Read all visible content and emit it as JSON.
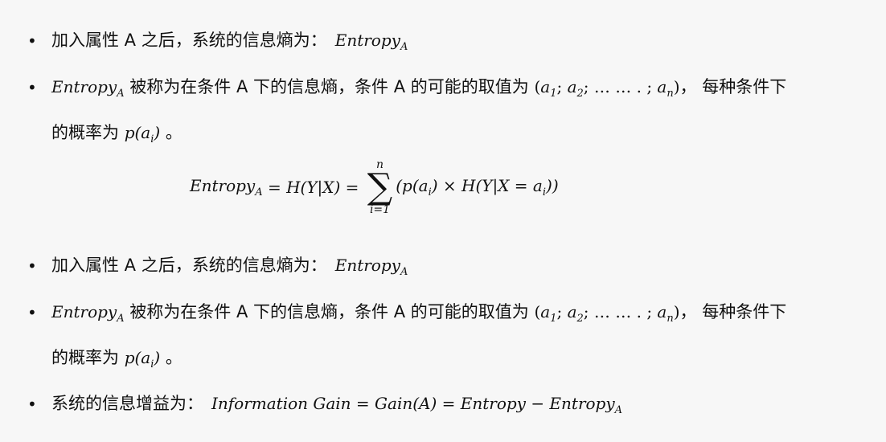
{
  "doc": {
    "bullet_symbol": "•",
    "item1": {
      "text": "加入属性 A 之后，系统的信息熵为：",
      "math_main": "Entropy",
      "math_sub": "A"
    },
    "item2": {
      "math_main": "Entropy",
      "math_sub": "A",
      "text_a": "被称为在条件 A 下的信息熵，条件 A 的可能的取值为",
      "open_paren": "(",
      "a1": "a",
      "a1_sub": "1",
      "sep1": "; ",
      "a2": "a",
      "a2_sub": "2",
      "sep2": "; … … . ; ",
      "an": "a",
      "an_sub": "n",
      "close_paren": ")",
      "text_b": "， 每种条件下",
      "cont_text": "的概率为",
      "p_expr": "p(a",
      "p_sub": "i",
      "p_close": ")",
      "end_mark": "。"
    },
    "formula": {
      "lhs_main": "Entropy",
      "lhs_sub": "A",
      "eq1": " = H(Y|X) = ",
      "sum_symbol": "∑",
      "sum_upper": "n",
      "sum_lower": "i=1",
      "term_start": "(p(a",
      "term_sub1": "i",
      "term_mid": ") × H(Y|X = a",
      "term_sub2": "i",
      "term_end": "))"
    },
    "item5": {
      "text": "系统的信息增益为：",
      "math": "Information Gain = Gain(A) = Entropy − Entropy",
      "math_sub": "A"
    }
  }
}
